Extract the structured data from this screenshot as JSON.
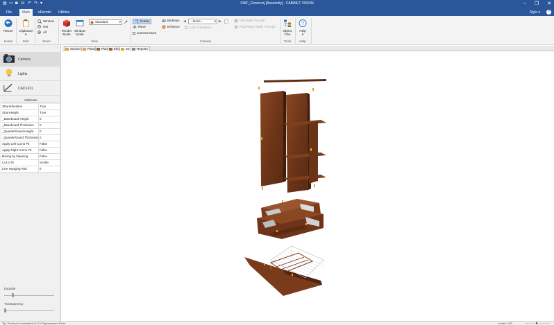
{
  "window": {
    "title": "SWC_Closet.mj [Assembly] - CABINET VISION",
    "minimize_glyph": "–",
    "restore_glyph": "❐",
    "close_glyph": "✕"
  },
  "quick_access": [
    "file-icon",
    "open-icon",
    "save-icon",
    "saveas-icon",
    "undo-icon",
    "redo-icon",
    "dropdown-icon"
  ],
  "tabs": [
    {
      "label": "File"
    },
    {
      "label": "Main"
    },
    {
      "label": "eRender"
    },
    {
      "label": "Utilities"
    }
  ],
  "style_menu": "Style",
  "help_glyph": "?",
  "ribbon": {
    "home": {
      "group": "Home",
      "return_label": "Return"
    },
    "edit": {
      "group": "Edit",
      "clipboard_label": "Clipboard"
    },
    "zoom": {
      "group": "Zoom",
      "window_label": "Window",
      "out_label": "Out",
      "all_label": "All"
    },
    "view": {
      "group": "View",
      "render_label": "Render",
      "render_label2": "Mode",
      "window_mode_label": "Window",
      "window_mode_label2": "Mode",
      "standard_value": "Standard"
    },
    "camera": {
      "group": "Camera",
      "rotate_label": "Rotate",
      "move_label": "Move",
      "camera_move_label": "Camera Move",
      "birdseye_label": "Birdseye",
      "enhance_label": "Enhance",
      "none_value": "--None--",
      "lock_orientation_label": "Lock Orientation",
      "edit_walk_label": "Edit Walk Through",
      "play_pause_label": "Play/Pause Walk Through"
    },
    "tools": {
      "group": "Tools",
      "object_tree_label": "Object",
      "object_tree_label2": "Tree"
    },
    "help": {
      "group": "Help",
      "help_label": "Help"
    }
  },
  "left_panel": {
    "items": [
      {
        "label": "Camera",
        "icon": "camera-icon"
      },
      {
        "label": "Lights",
        "icon": "light-bulb-icon"
      },
      {
        "label": "CAD (F3)",
        "icon": "cad-icon"
      }
    ],
    "attributes_header": "Attributes",
    "attributes": [
      {
        "key": "3DonElevation",
        "value": "True"
      },
      {
        "key": "3DonHeight",
        "value": "True"
      },
      {
        "key": "_Baseboard Height",
        "value": "0"
      },
      {
        "key": "_Baseboard Thickness",
        "value": "0"
      },
      {
        "key": "_QuarterRound Height",
        "value": "0"
      },
      {
        "key": "_QuarterRound Thickness",
        "value": "0"
      },
      {
        "key": "Apply Left Cut to Fit",
        "value": "False"
      },
      {
        "key": "Apply Right Cut to Fit",
        "value": "False"
      },
      {
        "key": "Boring by Opening",
        "value": "False"
      },
      {
        "key": "Cut to fit",
        "value": "Scribe"
      },
      {
        "key": "Line Hanging Rail",
        "value": "0"
      }
    ],
    "explode_label": "Explode",
    "explode_value": 0.15,
    "transparency_label": "Transparency",
    "transparency_value": 0.0
  },
  "view_tabs": [
    {
      "label": "Section",
      "active": false
    },
    {
      "label": "Plane",
      "active": false
    },
    {
      "label": "Plan",
      "active": false
    },
    {
      "label": "Elevation",
      "active": false
    },
    {
      "label": "3D",
      "active": true
    },
    {
      "label": "Reports",
      "active": false
    }
  ],
  "status": {
    "left": "Tip: Product is connected to CV Replacement Store",
    "right_label": "Inches",
    "right_value": "1/32"
  },
  "colors": {
    "titlebar": "#2b579a",
    "wood": "#7a3d1c",
    "wood_dark": "#4e2410",
    "handle": "#e8a020"
  }
}
